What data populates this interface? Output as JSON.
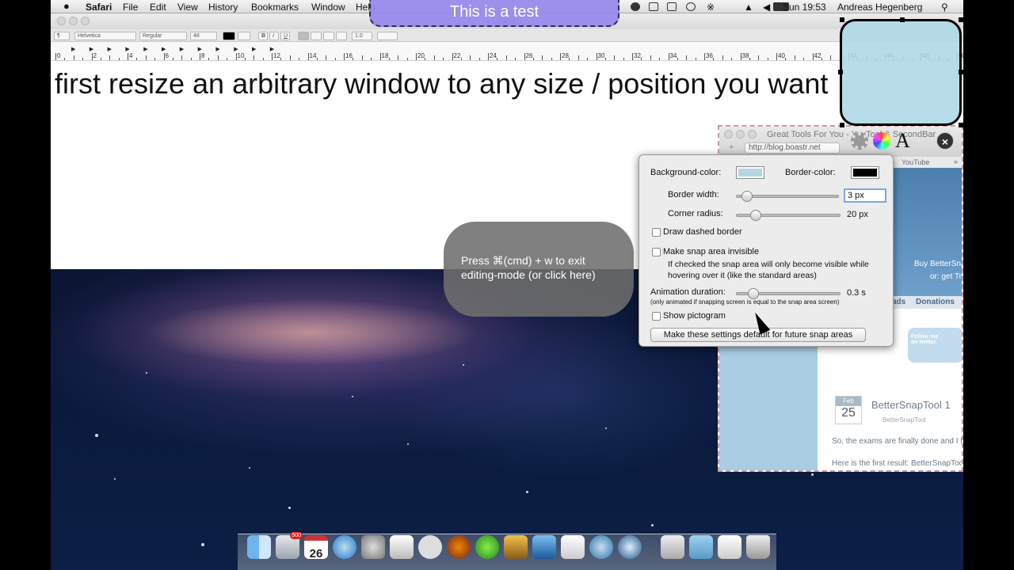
{
  "menubar": {
    "app": "Safari",
    "items": [
      "File",
      "Edit",
      "View",
      "History",
      "Bookmarks",
      "Window",
      "Help"
    ],
    "clock": "Sun 19:53",
    "user": "Andreas Hegenberg"
  },
  "overlay_title": "This is a test",
  "textedit": {
    "window_title": "Untitled",
    "toolbar": {
      "style": "¶",
      "font_family": "Helvetica",
      "font_style": "Regular",
      "font_size": "48",
      "line_spacing": "1.0"
    },
    "ruler_numbers": [
      "0",
      "2",
      "4",
      "6",
      "8",
      "10",
      "12",
      "14",
      "16",
      "18",
      "20",
      "22",
      "24",
      "26",
      "28",
      "30",
      "32",
      "34",
      "36",
      "38",
      "40",
      "42",
      "44",
      "46",
      "48",
      "50"
    ],
    "body_text": "first resize an arbitrary window to any size / position you want"
  },
  "bubble_text": "Press ⌘(cmd) + w to exit editing-mode (or click here)",
  "safari": {
    "title": "Great Tools For You - YouTool & SecondBar",
    "url": "http://blog.boastr.net",
    "bookmark": "YouTube",
    "nav_downloads": "ads",
    "nav_donations": "Donations",
    "buy_text": "Buy BetterSna",
    "trial_text": "or: get Tri",
    "twitter_text": "Follow me on twitter",
    "date_month": "Feb",
    "date_day": "25",
    "post_title": "BetterSnapTool 1",
    "post_tag": "BetterSnapTool",
    "post_line1": "So, the exams are finally done and I ha",
    "post_line2": "Here is the first result: BetterSnapTool"
  },
  "settings": {
    "bg_label": "Background-color:",
    "border_color_label": "Border-color:",
    "bg_color": "#b2d7e3",
    "border_color": "#000000",
    "border_width_label": "Border width:",
    "border_width_value": "3 px",
    "border_width_level": 0.05,
    "corner_radius_label": "Corner radius:",
    "corner_radius_value": "20 px",
    "corner_radius_level": 0.14,
    "dashed_label": "Draw dashed border",
    "invisible_label": "Make snap area invisible",
    "invisible_help": "If checked the snap area will only become visible while hovering over it (like the standard areas)",
    "anim_label": "Animation duration:",
    "anim_value": "0.3 s",
    "anim_level": 0.12,
    "anim_note": "(only animated if snapping screen is equal to the snap area screen)",
    "pictogram_label": "Show pictogram",
    "default_button": "Make these settings default for future snap areas"
  },
  "dock": {
    "calendar_day": "26",
    "mail_badge": "500"
  }
}
